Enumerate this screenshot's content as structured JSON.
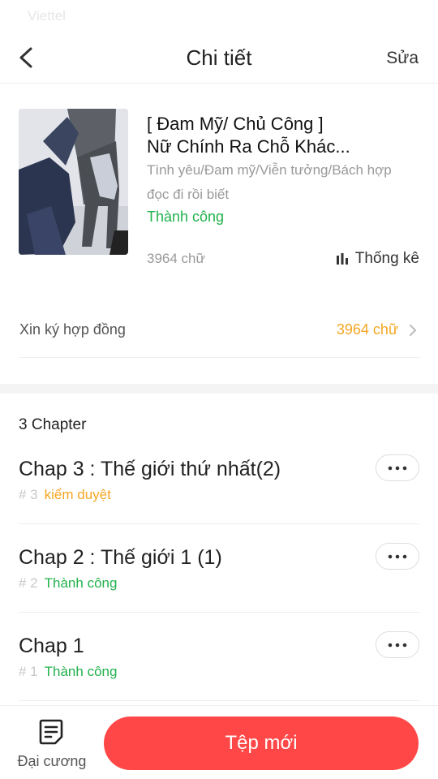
{
  "status_bar": {
    "carrier": "Viettel"
  },
  "nav": {
    "title": "Chi tiết",
    "edit_label": "Sửa"
  },
  "book": {
    "title_line1": "[ Đam Mỹ/ Chủ Công ]",
    "title_line2": "Nữ Chính Ra Chỗ Khác...",
    "genres": "Tình yêu/Đam mỹ/Viễn tưởng/Bách hợp",
    "description": "đọc đi rồi biết",
    "status": "Thành công",
    "word_count": "3964 chữ",
    "stats_label": "Thống kê"
  },
  "contract": {
    "label": "Xin ký hợp đồng",
    "value": "3964 chữ"
  },
  "chapters_header": "3 Chapter",
  "chapters": [
    {
      "title": "Chap 3 : Thế giới thứ nhất(2)",
      "number": "# 3",
      "status": "kiểm duyệt"
    },
    {
      "title": "Chap 2 : Thế giới 1 (1)",
      "number": "# 2",
      "status": "Thành công"
    },
    {
      "title": "Chap 1",
      "number": "# 1",
      "status": "Thành công"
    }
  ],
  "bottom": {
    "outline_label": "Đại cương",
    "new_label": "Tệp mới"
  },
  "colors": {
    "accent": "#ff4747",
    "success": "#22b14c",
    "warning": "#f5a623"
  },
  "icons": [
    "back-icon",
    "stats-icon",
    "chevron-right-icon",
    "more-icon",
    "outline-icon"
  ]
}
